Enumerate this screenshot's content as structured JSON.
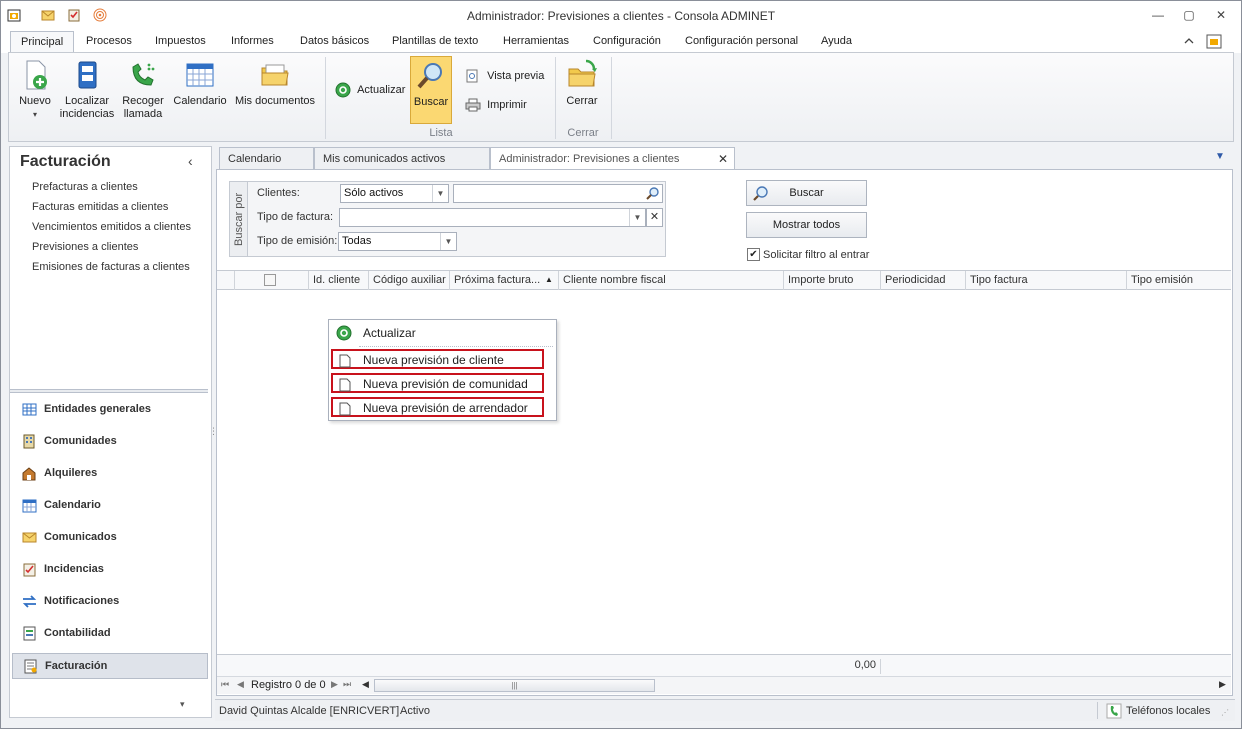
{
  "window": {
    "title": "Administrador: Previsiones a clientes - Consola ADMINET",
    "minimize": "—",
    "maximize": "▢",
    "close": "✕"
  },
  "ribbon_tabs": [
    "Principal",
    "Procesos",
    "Impuestos",
    "Informes",
    "Datos básicos",
    "Plantillas de texto",
    "Herramientas",
    "Configuración",
    "Configuración personal",
    "Ayuda"
  ],
  "ribbon": {
    "nuevo": "Nuevo",
    "localizar_1": "Localizar",
    "localizar_2": "incidencias",
    "recoger_1": "Recoger",
    "recoger_2": "llamada",
    "calendario": "Calendario",
    "mis_documentos": "Mis documentos",
    "actualizar": "Actualizar",
    "buscar": "Buscar",
    "vista_previa": "Vista previa",
    "imprimir": "Imprimir",
    "grupo_lista": "Lista",
    "cerrar": "Cerrar",
    "grupo_cerrar": "Cerrar"
  },
  "left_panel": {
    "title": "Facturación",
    "collapse": "‹",
    "links": [
      "Prefacturas a clientes",
      "Facturas emitidas a clientes",
      "Vencimientos emitidos a clientes",
      "Previsiones a clientes",
      "Emisiones de facturas a clientes"
    ],
    "nav": [
      "Entidades generales",
      "Comunidades",
      "Alquileres",
      "Calendario",
      "Comunicados",
      "Incidencias",
      "Notificaciones",
      "Contabilidad",
      "Facturación"
    ],
    "active_nav": "Facturación"
  },
  "doc_tabs": [
    "Calendario",
    "Mis comunicados activos",
    "Administrador: Previsiones a clientes"
  ],
  "doc_tab_close": "✕",
  "filter": {
    "group_label": "Buscar por",
    "clientes_label": "Clientes:",
    "clientes_value": "Sólo activos",
    "clientes_search": "",
    "tipo_factura_label": "Tipo de factura:",
    "tipo_factura_value": "",
    "tipo_emision_label": "Tipo de emisión:",
    "tipo_emision_value": "Todas",
    "buscar_button": "Buscar",
    "mostrar_todos_button": "Mostrar todos",
    "solicitar_filtro_label": "Solicitar filtro al entrar",
    "solicitar_filtro_checked": true
  },
  "grid": {
    "columns": [
      "Id. cliente",
      "Código auxiliar",
      "Próxima factura...",
      "Cliente nombre fiscal",
      "Importe bruto",
      "Periodicidad",
      "Tipo factura",
      "Tipo emisión"
    ],
    "sort_indicator": "▲",
    "rows": [],
    "total_importe": "0,00",
    "pager_text": "Registro 0 de 0"
  },
  "context_menu": [
    "Actualizar",
    "Nueva previsión de cliente",
    "Nueva previsión de comunidad",
    "Nueva previsión de arrendador"
  ],
  "status": {
    "user": "David Quintas Alcalde [ENRICVERT]",
    "state": "Activo",
    "phones": "Teléfonos locales"
  }
}
